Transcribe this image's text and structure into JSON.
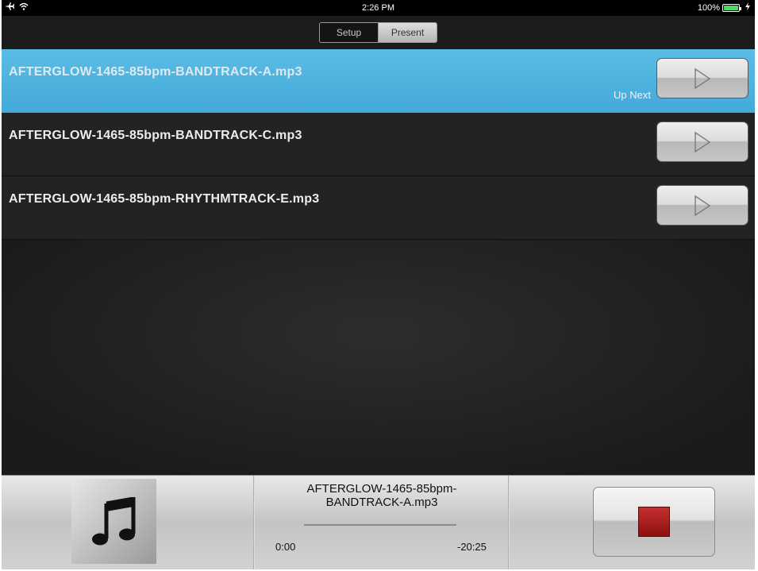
{
  "status_bar": {
    "time": "2:26 PM",
    "battery_text": "100%",
    "icons": [
      "airplane-icon",
      "wifi-icon",
      "battery-icon",
      "charging-icon"
    ],
    "battery_color": "#4cd964"
  },
  "mode_switch": {
    "options": [
      "Setup",
      "Present"
    ],
    "selected": "Present"
  },
  "tracks": [
    {
      "title": "AFTERGLOW-1465-85bpm-BANDTRACK-A.mp3",
      "state": "playing"
    },
    {
      "title": "AFTERGLOW-1465-85bpm-BANDTRACK-C.mp3",
      "state": "up-next"
    },
    {
      "title": "AFTERGLOW-1465-85bpm-RHYTHMTRACK-E.mp3",
      "state": "queued"
    }
  ],
  "up_next_label": "Up Next",
  "now_playing": {
    "title_line1": "AFTERGLOW-1465-85bpm-",
    "title_line2": "BANDTRACK-A.mp3",
    "elapsed": "0:00",
    "remaining": "-20:25",
    "progress": 0
  },
  "colors": {
    "active_row": "#4fb5e0",
    "stop_button": "#b01e1e"
  }
}
